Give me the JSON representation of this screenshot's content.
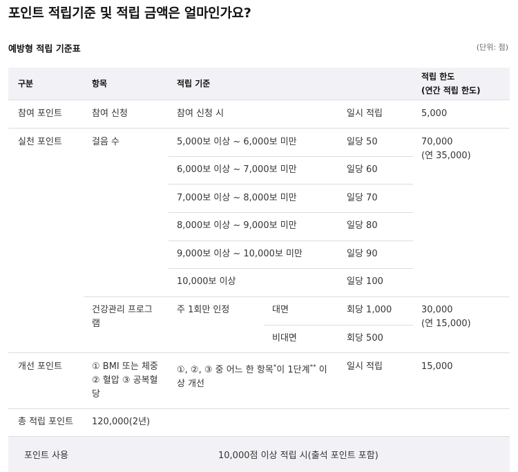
{
  "page_title": "포인트 적립기준 및 적립 금액은 얼마인가요?",
  "table_title": "예방형 적립 기준표",
  "unit": "(단위: 점)",
  "headers": {
    "category": "구분",
    "item": "항목",
    "criteria": "적립 기준",
    "limit_line1": "적립 한도",
    "limit_line2": "(연간 적립 한도)"
  },
  "participation": {
    "category": "참여 포인트",
    "item": "참여 신청",
    "criteria": "참여 신청 시",
    "amount": "일시 적립",
    "limit": "5,000"
  },
  "practice": {
    "category": "실천 포인트",
    "steps": {
      "item": "걸음 수",
      "rows": [
        {
          "criteria": "5,000보 이상 ~ 6,000보 미만",
          "amount": "일당 50"
        },
        {
          "criteria": "6,000보 이상 ~ 7,000보 미만",
          "amount": "일당 60"
        },
        {
          "criteria": "7,000보 이상 ~ 8,000보 미만",
          "amount": "일당 70"
        },
        {
          "criteria": "8,000보 이상 ~ 9,000보 미만",
          "amount": "일당 80"
        },
        {
          "criteria": "9,000보 이상 ~ 10,000보 미만",
          "amount": "일당 90"
        },
        {
          "criteria": "10,000보 이상",
          "amount": "일당 100"
        }
      ],
      "limit_line1": "70,000",
      "limit_line2": "(연 35,000)"
    },
    "health_program": {
      "item_line1": "건강관리 프로그",
      "item_line2": "램",
      "criteria": "주 1회만 인정",
      "rows": [
        {
          "type": "대면",
          "amount": "회당 1,000"
        },
        {
          "type": "비대면",
          "amount": "회당 500"
        }
      ],
      "limit_line1": "30,000",
      "limit_line2": "(연 15,000)"
    }
  },
  "improvement": {
    "category": "개선 포인트",
    "item_line1": "① BMI 또는 체중",
    "item_line2": "② 혈압 ③ 공복혈",
    "item_line3": "당",
    "criteria_part1": "①, ②, ③ 중 어느 한 항목",
    "criteria_sup1": "*",
    "criteria_part2": "이 1단계",
    "criteria_sup2": "**",
    "criteria_part3": " 이",
    "criteria_line2": "상 개선",
    "amount": "일시 적립",
    "limit": "15,000"
  },
  "total": {
    "label": "총 적립 포인트",
    "value": "120,000(2년)"
  },
  "usage": {
    "label": "포인트 사용",
    "value": "10,000점 이상 적립 시(출석 포인트 포함)"
  }
}
